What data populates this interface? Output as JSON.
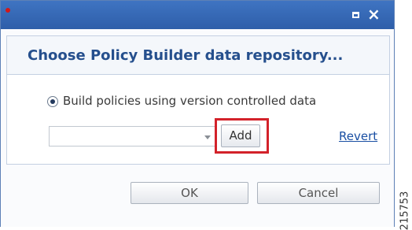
{
  "window": {
    "accent": "#2e5ea9",
    "maximize_icon": "maximize-icon",
    "close_icon": "close-icon",
    "close_glyph": "×"
  },
  "dialog": {
    "title": "Choose Policy Builder data repository..."
  },
  "options": {
    "radio_label": "Build policies using version controlled data",
    "selected": true
  },
  "repository": {
    "selected_value": "",
    "add_label": "Add",
    "revert_label": "Revert",
    "highlight_color": "#d3222a"
  },
  "footer": {
    "ok_label": "OK",
    "cancel_label": "Cancel"
  },
  "figure": {
    "id": "215753"
  }
}
